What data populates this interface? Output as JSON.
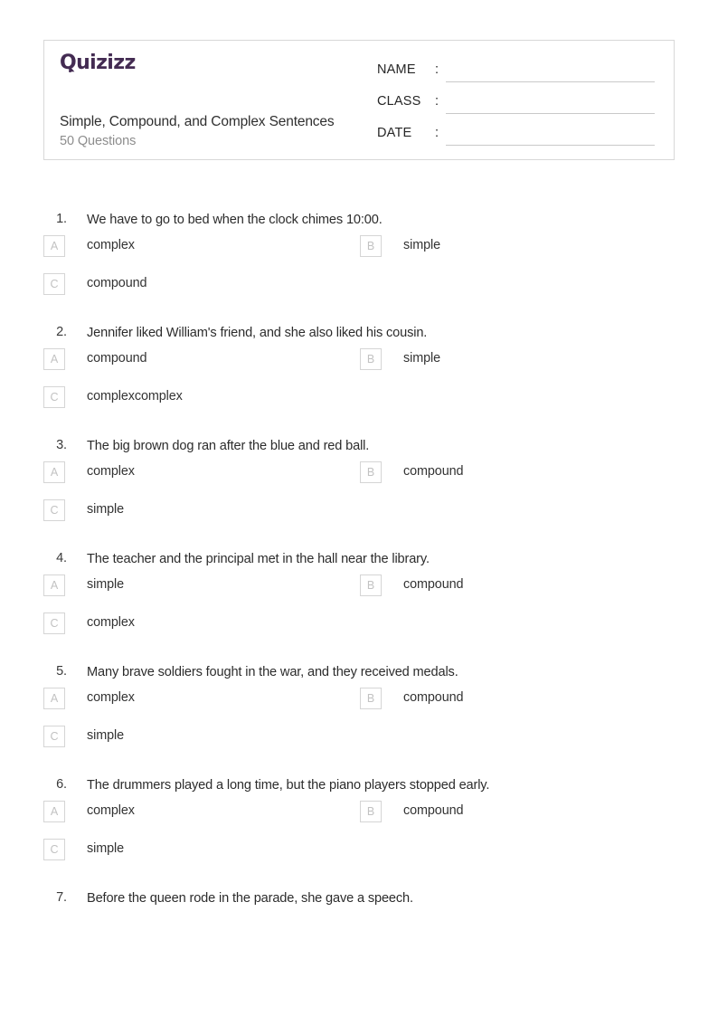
{
  "header": {
    "logo_text": "Quizizz",
    "logo_color": "#432b52",
    "title": "Simple, Compound, and Complex Sentences",
    "subtitle": "50 Questions",
    "fields": [
      {
        "label": "NAME",
        "colon": ":",
        "value": ""
      },
      {
        "label": "CLASS",
        "colon": ":",
        "value": ""
      },
      {
        "label": "DATE",
        "colon": ":",
        "value": ""
      }
    ]
  },
  "questions": [
    {
      "number": "1.",
      "text": "We have to go to bed when the clock chimes 10:00.",
      "options": [
        {
          "letter": "A",
          "text": "complex"
        },
        {
          "letter": "B",
          "text": "simple"
        },
        {
          "letter": "C",
          "text": "compound"
        }
      ]
    },
    {
      "number": "2.",
      "text": "Jennifer liked William's friend, and she also liked his cousin.",
      "options": [
        {
          "letter": "A",
          "text": "compound"
        },
        {
          "letter": "B",
          "text": "simple"
        },
        {
          "letter": "C",
          "text": "complexcomplex"
        }
      ]
    },
    {
      "number": "3.",
      "text": "The big brown dog ran after the blue and red ball.",
      "options": [
        {
          "letter": "A",
          "text": "complex"
        },
        {
          "letter": "B",
          "text": "compound"
        },
        {
          "letter": "C",
          "text": "simple"
        }
      ]
    },
    {
      "number": "4.",
      "text": "The teacher and the principal met in the hall near the library.",
      "options": [
        {
          "letter": "A",
          "text": "simple"
        },
        {
          "letter": "B",
          "text": "compound"
        },
        {
          "letter": "C",
          "text": "complex"
        }
      ]
    },
    {
      "number": "5.",
      "text": "Many brave soldiers fought in the war, and they received medals.",
      "options": [
        {
          "letter": "A",
          "text": "complex"
        },
        {
          "letter": "B",
          "text": "compound"
        },
        {
          "letter": "C",
          "text": "simple"
        }
      ]
    },
    {
      "number": "6.",
      "text": "The drummers played a long time, but the piano players stopped early.",
      "options": [
        {
          "letter": "A",
          "text": "complex"
        },
        {
          "letter": "B",
          "text": "compound"
        },
        {
          "letter": "C",
          "text": "simple"
        }
      ]
    },
    {
      "number": "7.",
      "text": "Before the queen rode in the parade, she gave a speech.",
      "options": []
    }
  ]
}
